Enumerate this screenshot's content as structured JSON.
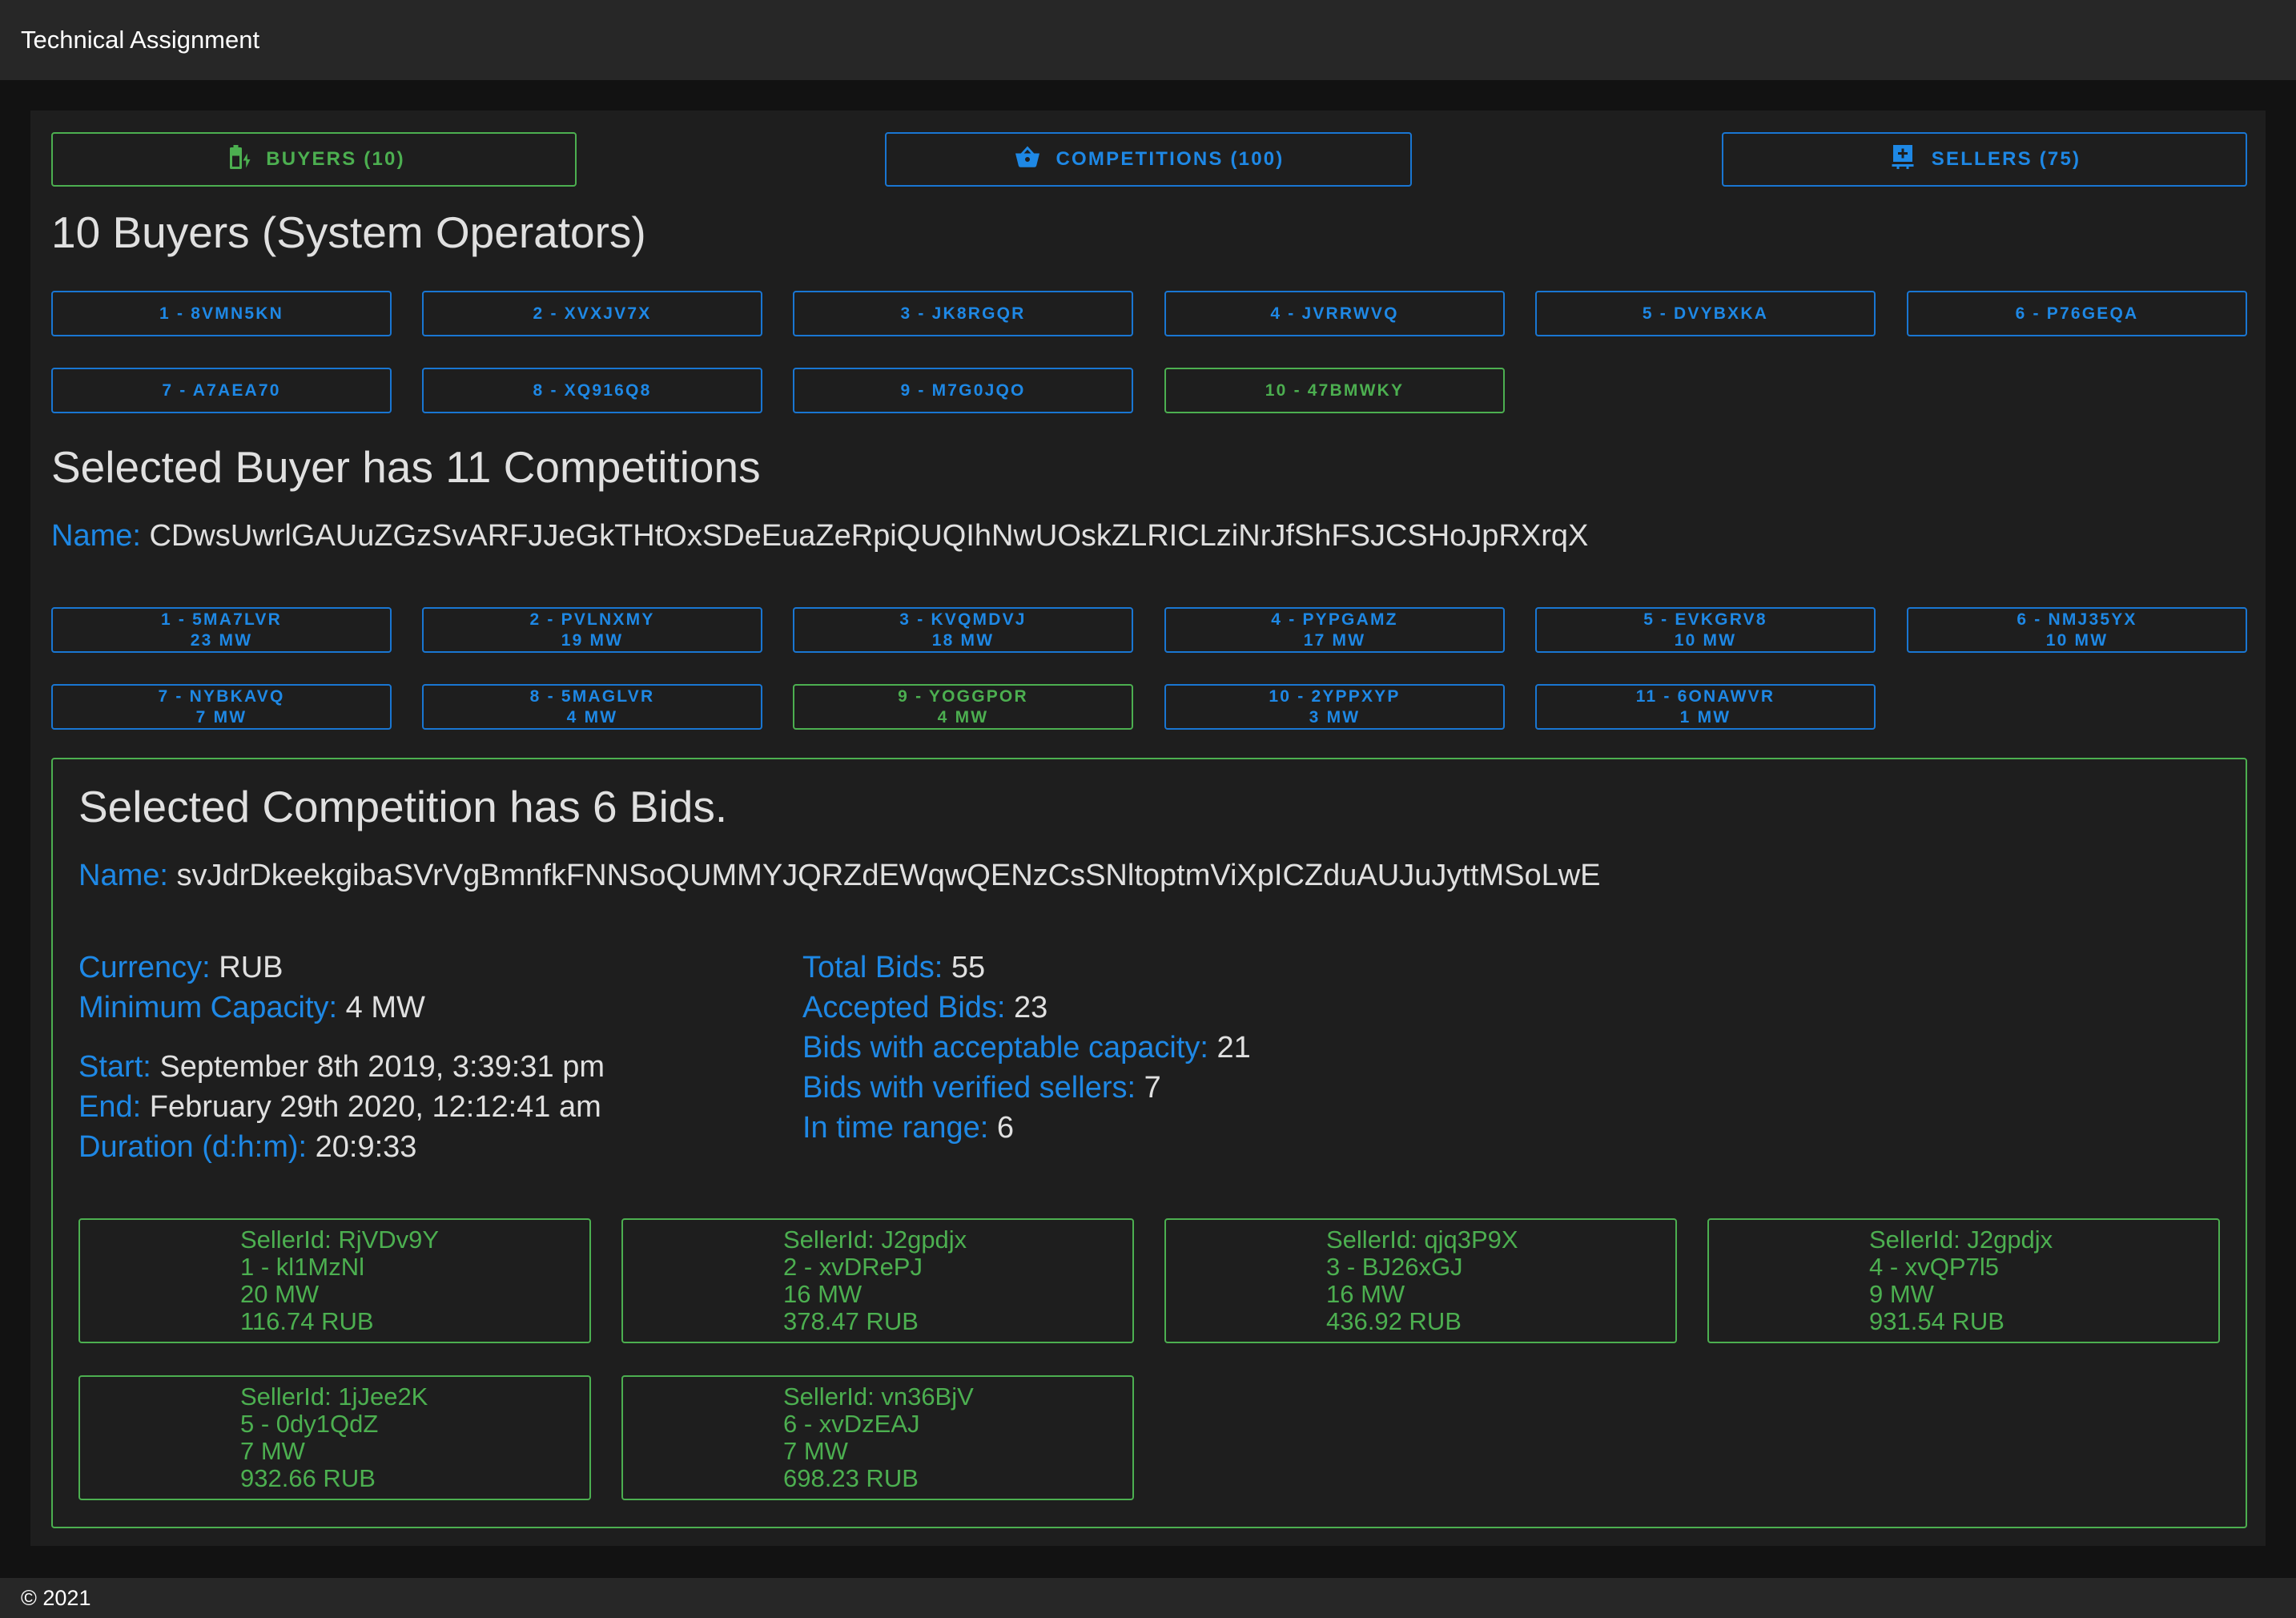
{
  "app": {
    "title": "Technical Assignment",
    "footer": "© 2021"
  },
  "tabs": [
    {
      "label": "BUYERS (10)",
      "icon": "battery-charging-icon"
    },
    {
      "label": "COMPETITIONS (100)",
      "icon": "basket-icon"
    },
    {
      "label": "SELLERS (75)",
      "icon": "transmission-tower-icon"
    }
  ],
  "buyers": {
    "heading": "10 Buyers (System Operators)",
    "items": [
      "1 - 8VMN5KN",
      "2 - XVXJV7X",
      "3 - JK8RGQR",
      "4 - JVRRWVQ",
      "5 - DVYBXKA",
      "6 - P76GEQA",
      "7 - A7AEA70",
      "8 - XQ916Q8",
      "9 - M7G0JQO",
      "10 - 47BMWKY"
    ],
    "selected_index": 9
  },
  "buyer": {
    "heading": "Selected Buyer has 11 Competitions",
    "name_label": "Name:",
    "name": "CDwsUwrlGAUuZGzSvARFJJeGkTHtOxSDeEuaZeRpiQUQIhNwUOskZLRICLziNrJfShFSJCSHoJpRXrqX"
  },
  "competitions": {
    "items": [
      {
        "label": "1 - 5MA7LVR",
        "capacity": "23 MW"
      },
      {
        "label": "2 - PVLNXMY",
        "capacity": "19 MW"
      },
      {
        "label": "3 - KVQMDVJ",
        "capacity": "18 MW"
      },
      {
        "label": "4 - PYPGAMZ",
        "capacity": "17 MW"
      },
      {
        "label": "5 - EVKGRV8",
        "capacity": "10 MW"
      },
      {
        "label": "6 - NMJ35YX",
        "capacity": "10 MW"
      },
      {
        "label": "7 - NYBKAVQ",
        "capacity": "7 MW"
      },
      {
        "label": "8 - 5MAGLVR",
        "capacity": "4 MW"
      },
      {
        "label": "9 - YOGGPOR",
        "capacity": "4 MW"
      },
      {
        "label": "10 - 2YPPXYP",
        "capacity": "3 MW"
      },
      {
        "label": "11 - 6ONAWVR",
        "capacity": "1 MW"
      }
    ],
    "selected_index": 8
  },
  "competition": {
    "heading": "Selected Competition has 6 Bids.",
    "name_label": "Name:",
    "name": "svJdrDkeekgibaSVrVgBmnfkFNNSoQUMMYJQRZdEWqwQENzCsSNltoptmViXpICZduAUJuJyttMSoLwE",
    "currency_label": "Currency:",
    "currency": "RUB",
    "min_capacity_label": "Minimum Capacity:",
    "min_capacity": "4 MW",
    "start_label": "Start:",
    "start": "September 8th 2019, 3:39:31 pm",
    "end_label": "End:",
    "end": "February 29th 2020, 12:12:41 am",
    "duration_label": "Duration (d:h:m):",
    "duration": "20:9:33",
    "total_bids_label": "Total Bids:",
    "total_bids": "55",
    "accepted_bids_label": "Accepted Bids:",
    "accepted_bids": "23",
    "acceptable_capacity_label": "Bids with acceptable capacity:",
    "acceptable_capacity": "21",
    "verified_sellers_label": "Bids with verified sellers:",
    "verified_sellers": "7",
    "in_time_range_label": "In time range:",
    "in_time_range": "6"
  },
  "bids": [
    {
      "seller": "SellerId: RjVDv9Y",
      "bid": "1 - kl1MzNl",
      "capacity": "20 MW",
      "price": "116.74 RUB"
    },
    {
      "seller": "SellerId: J2gpdjx",
      "bid": "2 - xvDRePJ",
      "capacity": "16 MW",
      "price": "378.47 RUB"
    },
    {
      "seller": "SellerId: qjq3P9X",
      "bid": "3 - BJ26xGJ",
      "capacity": "16 MW",
      "price": "436.92 RUB"
    },
    {
      "seller": "SellerId: J2gpdjx",
      "bid": "4 - xvQP7l5",
      "capacity": "9 MW",
      "price": "931.54 RUB"
    },
    {
      "seller": "SellerId: 1jJee2K",
      "bid": "5 - 0dy1QdZ",
      "capacity": "7 MW",
      "price": "932.66 RUB"
    },
    {
      "seller": "SellerId: vn36BjV",
      "bid": "6 - xvDzEAJ",
      "capacity": "7 MW",
      "price": "698.23 RUB"
    }
  ],
  "colors": {
    "accent": "#1e88e5",
    "selected": "#4caf50",
    "background": "#121212",
    "surface": "#1e1e1e",
    "appbar": "#272727"
  }
}
